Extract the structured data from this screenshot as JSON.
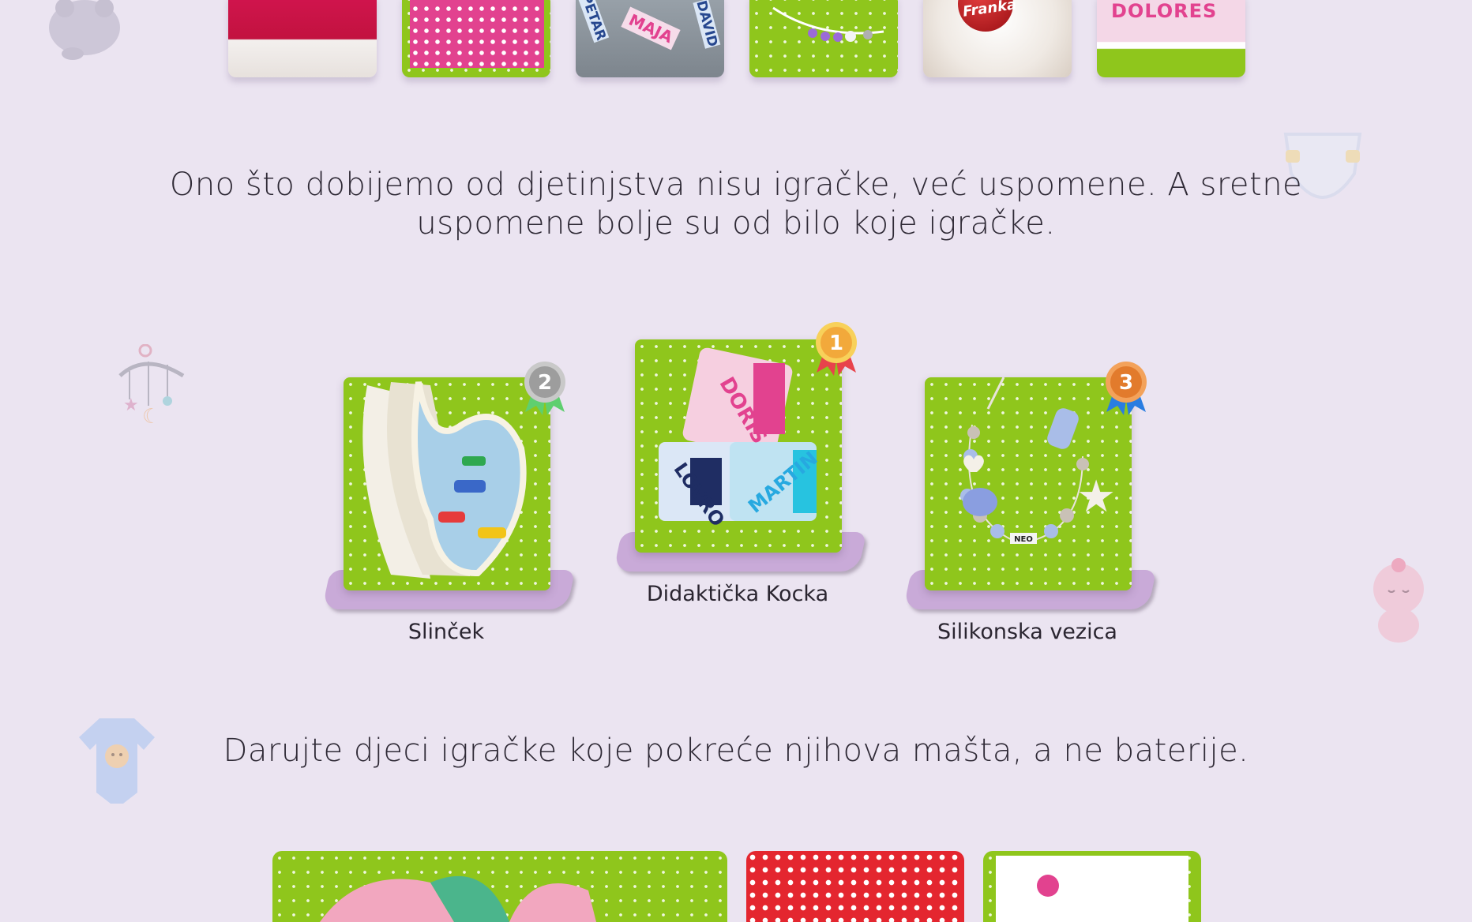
{
  "quotes": {
    "first_line1": "Ono što dobijemo od djetinjstva nisu igračke, već uspomene. A sretne",
    "first_line2": "uspomene bolje su od bilo koje igračke.",
    "second": "Darujte djeci igračke koje pokreće njihova mašta, a ne baterije."
  },
  "thumbnails": [
    {
      "name": "santa-hat",
      "text": ""
    },
    {
      "name": "pink-dots-fabric",
      "text": ""
    },
    {
      "name": "name-cubes",
      "labels": [
        "PETAR",
        "MAJA",
        "DAVID"
      ]
    },
    {
      "name": "pacifier-clip",
      "text": ""
    },
    {
      "name": "christmas-ornament",
      "text": "Franka"
    },
    {
      "name": "name-frame",
      "text": "DOLORES"
    }
  ],
  "podium": [
    {
      "rank": "2",
      "name": "Slinček",
      "medal_color": "#9d9d9d",
      "ribbon_color": "#5fcf6f"
    },
    {
      "rank": "1",
      "name": "Didaktička Kocka",
      "medal_color": "#f2a93b",
      "ribbon_color": "#e8434b"
    },
    {
      "rank": "3",
      "name": "Silikonska vezica",
      "medal_color": "#e27b2c",
      "ribbon_color": "#2a7de1"
    }
  ],
  "cube_labels": [
    "DORIS",
    "LOVRO",
    "MARTIN"
  ],
  "necklace_beads_text": "NEO",
  "colors": {
    "background": "#ebe4f1",
    "podium_stand": "#c9aad8",
    "fabric_green": "#8fc61c"
  },
  "decorations": [
    "hippo-icon",
    "diaper-icon",
    "baby-mobile-icon",
    "baby-doll-icon",
    "onesie-icon"
  ]
}
